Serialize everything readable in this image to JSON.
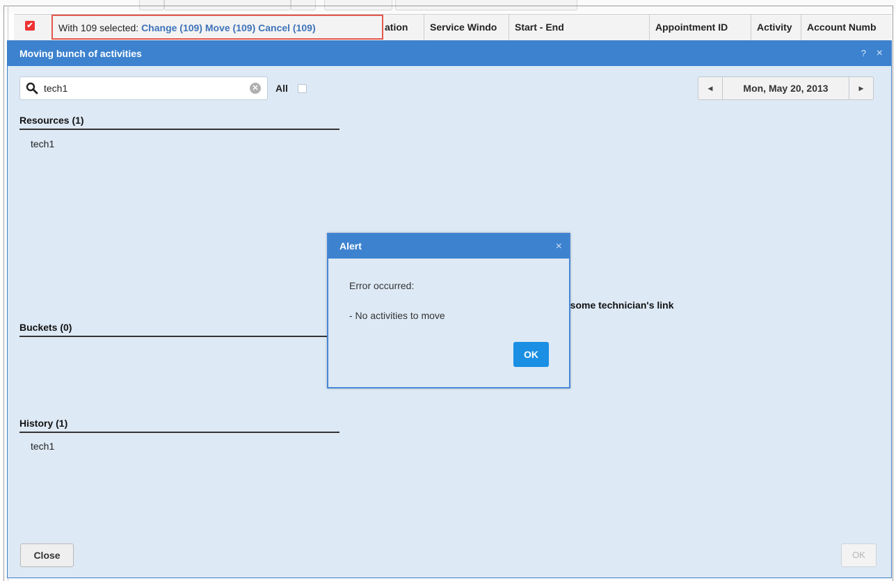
{
  "grid": {
    "selection_text": "With 109 selected:",
    "change_link": "Change (109)",
    "move_link": "Move (109)",
    "cancel_link": "Cancel (109)",
    "columns": [
      "ation",
      "Service Windo",
      "Start - End",
      "Appointment ID",
      "Activity",
      "Account Numb"
    ]
  },
  "dialog": {
    "title": "Moving bunch of activities",
    "help": "?",
    "close_glyph": "×",
    "search": {
      "value": "tech1",
      "placeholder": ""
    },
    "all_label": "All",
    "date": "Mon, May 20, 2013",
    "resources": {
      "title": "Resources (1)",
      "items": [
        "tech1"
      ]
    },
    "buckets": {
      "title": "Buckets (0)",
      "items": []
    },
    "history": {
      "title": "History (1)",
      "items": [
        "tech1"
      ]
    },
    "hint": "k some technician's link",
    "close_button": "Close",
    "ok_button": "OK"
  },
  "alert": {
    "title": "Alert",
    "close_glyph": "×",
    "line1": "Error occurred:",
    "line2": "- No activities to move",
    "ok_button": "OK"
  },
  "colors": {
    "titlebar": "#3c82cf",
    "dialog_bg": "#dde9f5",
    "link": "#3f73b9",
    "highlight_border": "#e4574d",
    "primary_button": "#1a8fe3"
  },
  "icons": {
    "checkbox": "checked-checkbox-icon",
    "search": "search-icon",
    "clear": "clear-icon",
    "prev": "chevron-left-icon",
    "next": "chevron-right-icon",
    "close": "close-icon"
  }
}
